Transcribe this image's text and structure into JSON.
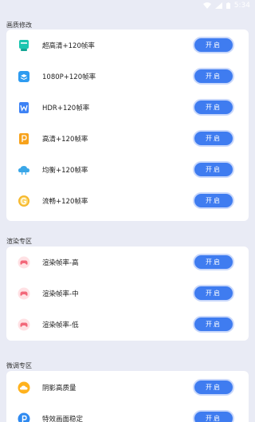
{
  "status_bar": {
    "time": "5:34"
  },
  "colors": {
    "background": "#e9ebf5",
    "button": "#3f7cf0",
    "card": "#ffffff"
  },
  "sections": [
    {
      "title": "画质修改",
      "items": [
        {
          "label": "超高清+120帧率",
          "button": "开启",
          "icon": "screen-icon"
        },
        {
          "label": "1080P+120帧率",
          "button": "开启",
          "icon": "layers-icon"
        },
        {
          "label": "HDR+120帧率",
          "button": "开启",
          "icon": "w-badge-icon"
        },
        {
          "label": "高清+120帧率",
          "button": "开启",
          "icon": "p-badge-icon"
        },
        {
          "label": "均衡+120帧率",
          "button": "开启",
          "icon": "cloud-icon"
        },
        {
          "label": "流畅+120帧率",
          "button": "开启",
          "icon": "g-coin-icon"
        }
      ]
    },
    {
      "title": "渲染专区",
      "items": [
        {
          "label": "渲染帧率-高",
          "button": "开启",
          "icon": "gamepad-icon"
        },
        {
          "label": "渲染帧率-中",
          "button": "开启",
          "icon": "gamepad-icon"
        },
        {
          "label": "渲染帧率-低",
          "button": "开启",
          "icon": "gamepad-icon"
        }
      ]
    },
    {
      "title": "微调专区",
      "items": [
        {
          "label": "阴影高质量",
          "button": "开启",
          "icon": "cloud-orange-icon"
        },
        {
          "label": "特效画面稳定",
          "button": "开启",
          "icon": "p-blue-icon"
        }
      ]
    }
  ]
}
